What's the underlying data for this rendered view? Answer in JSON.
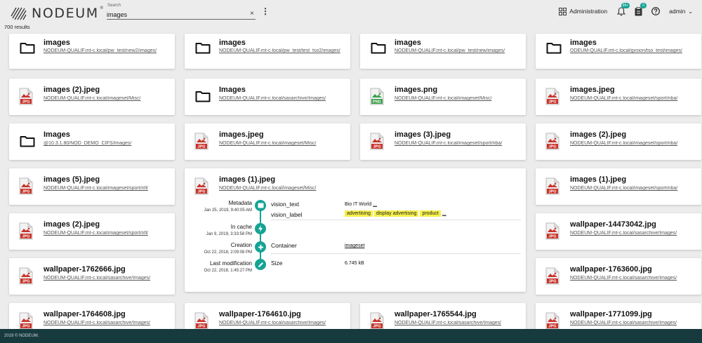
{
  "header": {
    "logo_text": "NODEUM",
    "logo_reg": "®",
    "search_label": "Search",
    "search_value": "images",
    "clear_icon": "×",
    "kebab": "⋮",
    "results": "700 results",
    "administration": "Administration",
    "notifications_badge": "99+",
    "tasks_badge": "0",
    "user": "admin",
    "user_chevron": "⌄"
  },
  "cards": [
    {
      "name": "images",
      "path": "NODEUM-QUALIF.mt-c.local/pw_test/new2/images/",
      "icon": "folder-icon"
    },
    {
      "name": "images",
      "path": "NODEUM-QUALIF.mt-c.local/pw_test/test_tso2/images/",
      "icon": "folder-icon"
    },
    {
      "name": "images",
      "path": "NODEUM-QUALIF.mt-c.local/pw_test/new/images/",
      "icon": "folder-icon"
    },
    {
      "name": "images",
      "path": "ODEUM-QUALIF.mt-c.local/gvsion/tso_test/images/",
      "icon": "folder-icon"
    },
    {
      "name": "images (2).jpeg",
      "path": "NODEUM-QUALIF.mt-c.local/imageset/Misc/",
      "icon": "jpg-file-icon"
    },
    {
      "name": "Images",
      "path": "NODEUM-QUALIF.mt-c.local/sasarchive/Images/",
      "icon": "folder-icon"
    },
    {
      "name": "images.png",
      "path": "NODEUM-QUALIF.mt-c.local/imageset/Misc/",
      "icon": "png-file-icon"
    },
    {
      "name": "images.jpeg",
      "path": "NODEUM-QUALIF.mt-c.local/imageset/sport/nba/",
      "icon": "jpg-file-icon"
    },
    {
      "name": "Images",
      "path": "@10.3.1.80/NOD_DEMO_CIFS/Images/",
      "icon": "folder-icon"
    },
    {
      "name": "images.jpeg",
      "path": "NODEUM-QUALIF.mt-c.local/imageset/Misc/",
      "icon": "jpg-file-icon"
    },
    {
      "name": "images (3).jpeg",
      "path": "NODEUM-QUALIF.mt-c.local/imageset/sport/nba/",
      "icon": "jpg-file-icon"
    },
    {
      "name": "images (2).jpeg",
      "path": "NODEUM-QUALIF.mt-c.local/imageset/sport/nba/",
      "icon": "jpg-file-icon"
    },
    {
      "name": "images (5).jpeg",
      "path": "NODEUM-QUALIF.mt-c.local/imageset/sport/nfl/",
      "icon": "jpg-file-icon"
    },
    {
      "name": "images (1).jpeg",
      "path": "NODEUM-QUALIF.mt-c.local/imageset/sport/nba/",
      "icon": "jpg-file-icon"
    },
    {
      "name": "images (2).jpeg",
      "path": "NODEUM-QUALIF.mt-c.local/imageset/sport/nfl/",
      "icon": "jpg-file-icon"
    },
    {
      "name": "wallpaper-14473042.jpg",
      "path": "NODEUM-QUALIF.mt-c.local/sasarchive/Images/",
      "icon": "jpg-file-icon"
    },
    {
      "name": "wallpaper-1762666.jpg",
      "path": "NODEUM-QUALIF.mt-c.local/sasarchive/Images/",
      "icon": "jpg-file-icon"
    },
    {
      "name": "wallpaper-1763600.jpg",
      "path": "NODEUM-QUALIF.mt-c.local/sasarchive/Images/",
      "icon": "jpg-file-icon"
    },
    {
      "name": "wallpaper-1764608.jpg",
      "path": "NODEUM-QUALIF.mt-c.local/sasarchive/Images/",
      "icon": "jpg-file-icon"
    },
    {
      "name": "wallpaper-1764610.jpg",
      "path": "NODEUM-QUALIF.mt-c.local/sasarchive/Images/",
      "icon": "jpg-file-icon"
    },
    {
      "name": "wallpaper-1765544.jpg",
      "path": "NODEUM-QUALIF.mt-c.local/sasarchive/Images/",
      "icon": "jpg-file-icon"
    },
    {
      "name": "wallpaper-1771099.jpg",
      "path": "NODEUM-QUALIF.mt-c.local/sasarchive/Images/",
      "icon": "jpg-file-icon"
    }
  ],
  "expanded": {
    "name": "images (1).jpeg",
    "path": "NODEUM-QUALIF.mt-c.local/imageset/Misc/",
    "timeline": [
      {
        "label": "Metadata",
        "date": "Jan 25, 2019, 9:40:05 AM",
        "icon": "tag-icon"
      },
      {
        "label": "In cache",
        "date": "Jan 9, 2019, 3:33:58 PM",
        "icon": "lightning-icon"
      },
      {
        "label": "Creation",
        "date": "Oct 22, 2018, 2:09:08 PM",
        "icon": "plus-icon"
      },
      {
        "label": "Last modification",
        "date": "Oct 22, 2018, 1:45:27 PM",
        "icon": "pencil-icon"
      }
    ],
    "vision_text_key": "vision_text",
    "vision_text_value": "Bio IT World",
    "more": "...",
    "vision_label_key": "vision_label",
    "tags": [
      "advertising",
      "display advertising",
      "product"
    ],
    "container_key": "Container",
    "container_value": "imageset",
    "size_key": "Size",
    "size_value": "6.745 kB"
  },
  "footer": {
    "text": "2019 © NODEUM."
  },
  "colors": {
    "accent": "#15a394",
    "footer": "#173a3f",
    "jpg": "#c8342b",
    "png": "#3ba04b"
  }
}
